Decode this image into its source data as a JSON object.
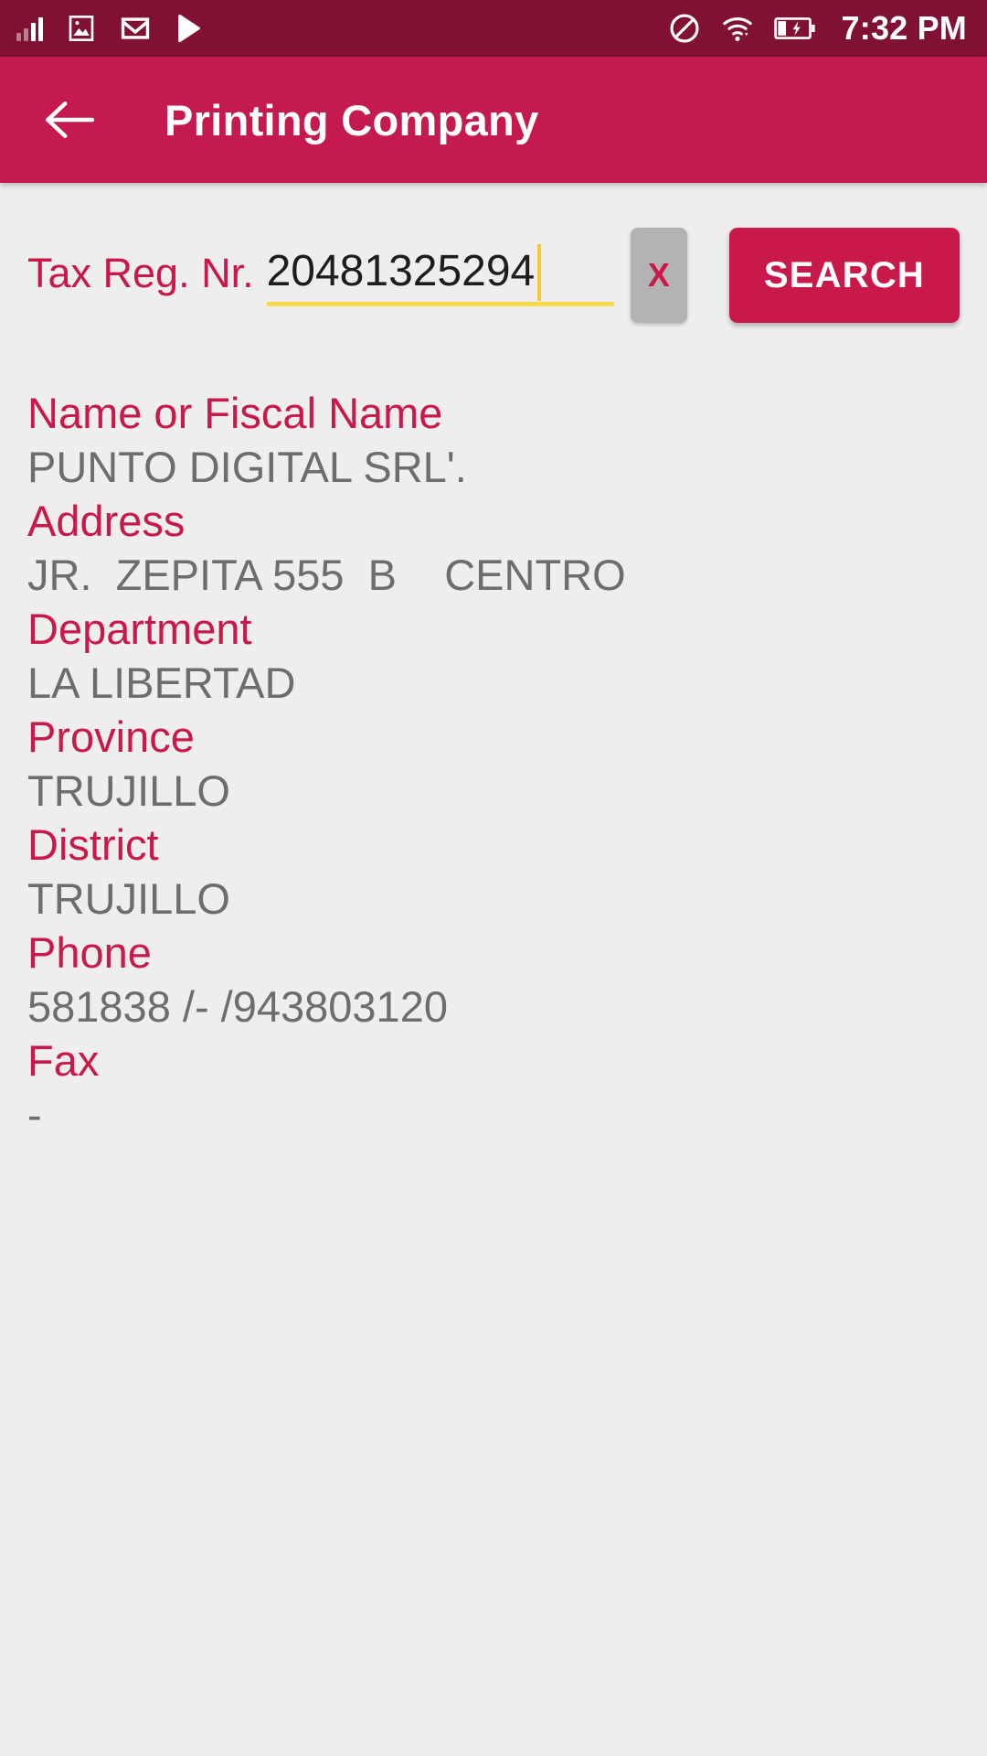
{
  "status_bar": {
    "icons_left": [
      "signal-bars-icon",
      "gallery-image-icon",
      "gmail-icon",
      "play-store-icon"
    ],
    "icons_right": [
      "do-not-disturb-icon",
      "wifi-icon",
      "battery-charging-icon"
    ],
    "time": "7:32 PM",
    "background_color": "#811133"
  },
  "app_bar": {
    "back_icon": "back-arrow-icon",
    "title": "Printing Company",
    "background_color": "#c41a4d"
  },
  "search": {
    "label": "Tax Reg. Nr.",
    "value": "20481325294",
    "placeholder": "Tax Reg. Nr.",
    "clear_label": "X",
    "search_label": "SEARCH",
    "underline_color": "#f7d94c",
    "accent_color": "#c9184a"
  },
  "details": [
    {
      "label": "Name or Fiscal Name",
      "value": "PUNTO DIGITAL SRL'."
    },
    {
      "label": "Address",
      "value": "JR.  ZEPITA 555  B    CENTRO"
    },
    {
      "label": "Department",
      "value": "LA LIBERTAD"
    },
    {
      "label": "Province",
      "value": "TRUJILLO"
    },
    {
      "label": "District",
      "value": "TRUJILLO"
    },
    {
      "label": "Phone",
      "value": "581838 /- /943803120"
    },
    {
      "label": "Fax",
      "value": "-"
    }
  ],
  "theme": {
    "page_background": "#efeeee",
    "label_color": "#c9184a",
    "value_color": "#6d6d6d"
  }
}
